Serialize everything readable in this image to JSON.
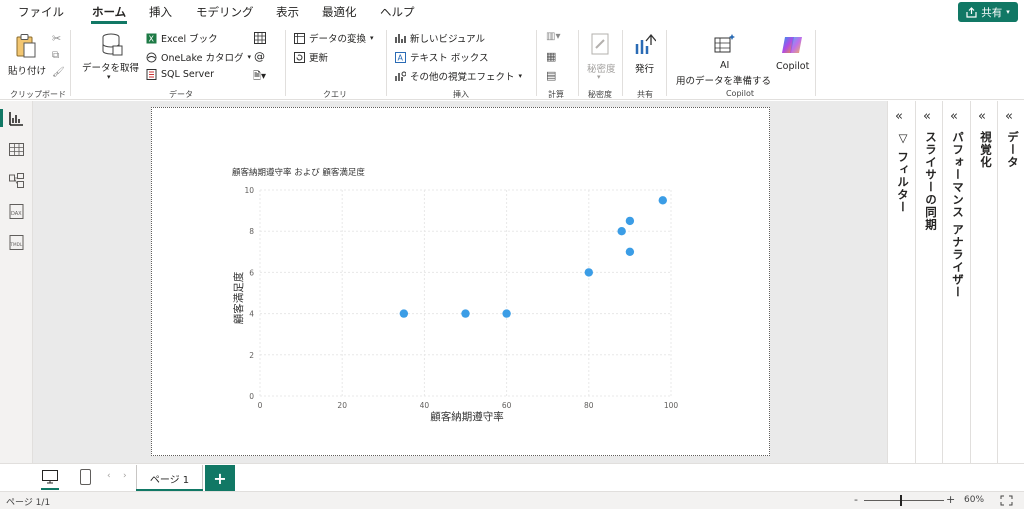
{
  "menubar": {
    "items": [
      "ファイル",
      "ホーム",
      "挿入",
      "モデリング",
      "表示",
      "最適化",
      "ヘルプ"
    ],
    "active": "ホーム",
    "share_label": "共有"
  },
  "ribbon": {
    "clipboard": {
      "paste": "貼り付け",
      "group": "クリップボード"
    },
    "data": {
      "get_data": "データを取得",
      "excel": "Excel ブック",
      "onelake": "OneLake カタログ",
      "sql": "SQL Server",
      "group": "データ"
    },
    "query": {
      "transform": "データの変換",
      "refresh": "更新",
      "group": "クエリ"
    },
    "insert": {
      "new_visual": "新しいビジュアル",
      "text_box": "テキスト ボックス",
      "more_visuals": "その他の視覚エフェクト",
      "group": "挿入"
    },
    "calc": {
      "group": "計算"
    },
    "sensitivity": {
      "label": "秘密度",
      "group": "秘密度"
    },
    "share": {
      "publish": "発行",
      "group": "共有"
    },
    "copilot": {
      "ai_line1": "AI",
      "ai_line2": "用のデータを準備する",
      "copilot": "Copilot",
      "group": "Copilot"
    }
  },
  "panes": {
    "filters": "フィルター",
    "slicer_sync": "スライサーの同期",
    "perf": "パフォーマンス アナライザー",
    "visualizations": "視覚化",
    "data": "データ"
  },
  "pages": {
    "tab1": "ページ 1",
    "add": "+"
  },
  "status": {
    "page": "ページ 1/1",
    "zoom": "60%"
  },
  "chart_data": {
    "type": "scatter",
    "title": "顧客納期遵守率 および 顧客満足度",
    "xlabel": "顧客納期遵守率",
    "ylabel": "顧客満足度",
    "xlim": [
      0,
      100
    ],
    "ylim": [
      0,
      10
    ],
    "xticks": [
      0,
      20,
      40,
      60,
      80,
      100
    ],
    "yticks": [
      0,
      2,
      4,
      6,
      8,
      10
    ],
    "points": [
      {
        "x": 35,
        "y": 4
      },
      {
        "x": 50,
        "y": 4
      },
      {
        "x": 60,
        "y": 4
      },
      {
        "x": 80,
        "y": 6
      },
      {
        "x": 88,
        "y": 8
      },
      {
        "x": 90,
        "y": 8.5
      },
      {
        "x": 90,
        "y": 7
      },
      {
        "x": 98,
        "y": 9.5
      }
    ],
    "color": "#3b9de6"
  },
  "colors": {
    "accent": "#117865"
  }
}
